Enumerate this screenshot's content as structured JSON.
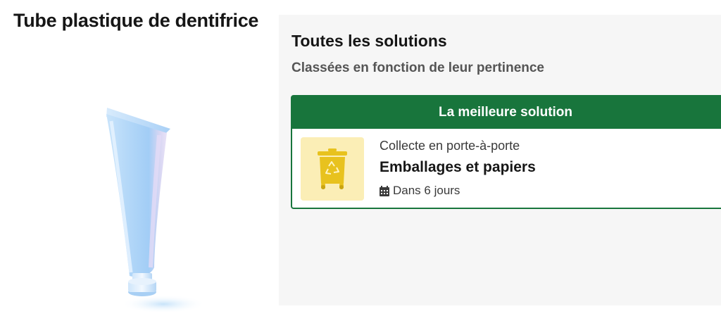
{
  "product": {
    "title": "Tube plastique de dentifrice",
    "illustration_icon": "toothpaste-tube-icon"
  },
  "solutions": {
    "title": "Toutes les solutions",
    "subtitle": "Classées en fonction de leur pertinence"
  },
  "best_solution": {
    "header_label": "La meilleure solution",
    "method": "Collecte en porte-à-porte",
    "destination": "Emballages et papiers",
    "schedule": "Dans 6 jours",
    "bin_icon": "yellow-recycling-bin-icon",
    "calendar_icon": "calendar-icon"
  },
  "colors": {
    "accent_green": "#18753c",
    "bin_yellow": "#e8c21e",
    "bin_tile_background": "#fbeeb6",
    "panel_background": "#f6f6f6"
  }
}
